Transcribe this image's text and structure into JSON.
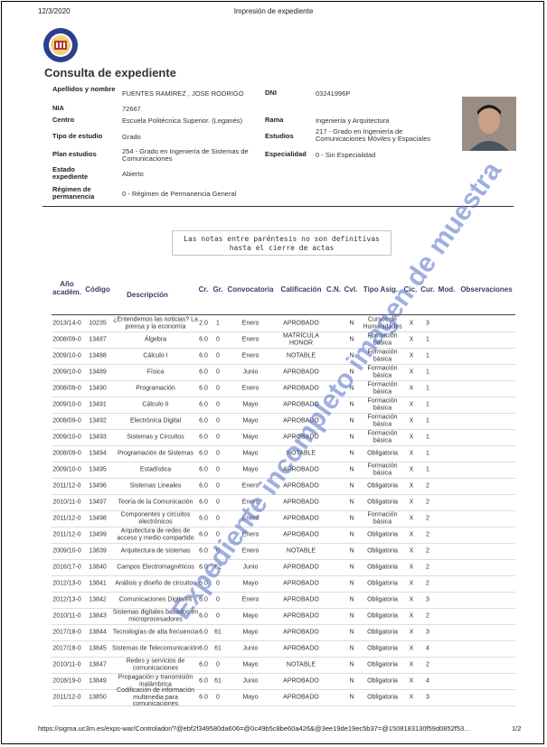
{
  "header": {
    "date": "12/3/2020",
    "title": "Impresión de expediente"
  },
  "page_title": "Consulta de expediente",
  "student": {
    "name_label": "Apellidos y nombre",
    "name": "FUENTES RAMIREZ , JOSE RODRIGO",
    "dni_label": "DNI",
    "dni": "03241996P",
    "nia_label": "NIA",
    "nia": "72667",
    "centro_label": "Centro",
    "centro": "Escuela Politécnica Superior. (Leganés)",
    "rama_label": "Rama",
    "rama": "Ingeniería y Arquitectura",
    "tipo_label": "Tipo de estudio",
    "tipo": "Grado",
    "estudios_label": "Estudios",
    "estudios": "217 - Grado en Ingeniería de Comunicaciones Móviles y Espaciales",
    "plan_label": "Plan estudios",
    "plan": "254 - Grado en Ingeniería de Sistemas de Comunicaciones",
    "especialidad_label": "Especialidad",
    "especialidad": "0 - Sin Especialidad",
    "estado_label": "Estado expediente",
    "estado": "Abierto",
    "regimen_label": "Régimen de permanencia",
    "regimen": "0 - Régimen de Permanencia General"
  },
  "notice": {
    "line1": "Las notas entre paréntesis no son definitivas",
    "line2": "hasta el cierre de actas"
  },
  "columns": [
    "Año académ.",
    "Código",
    "Descripción",
    "Cr.",
    "Gr.",
    "Convocatoria",
    "Calificación",
    "C.N.",
    "Cvl.",
    "Tipo Asig.",
    "Cic.",
    "Cur.",
    "Mod.",
    "Observaciones"
  ],
  "rows": [
    {
      "year": "2013/14-0",
      "code": "10235",
      "desc": "¿Entendemos las noticias? La prensa y la economía",
      "cr": "2.0",
      "gr": "1",
      "conv": "Enero",
      "calif": "APROBADO",
      "cn": "N",
      "tipo": "Cursos de Humanidades",
      "cic": "X",
      "cur": "3"
    },
    {
      "year": "2008/09-0",
      "code": "13487",
      "desc": "Álgebra",
      "cr": "6.0",
      "gr": "0",
      "conv": "Enero",
      "calif": "MATRÍCULA HONOR",
      "cn": "N",
      "tipo": "Formación básica",
      "cic": "X",
      "cur": "1"
    },
    {
      "year": "2009/10-0",
      "code": "13488",
      "desc": "Cálculo I",
      "cr": "6.0",
      "gr": "0",
      "conv": "Enero",
      "calif": "NOTABLE",
      "cn": "N",
      "tipo": "Formación básica",
      "cic": "X",
      "cur": "1"
    },
    {
      "year": "2009/10-0",
      "code": "13489",
      "desc": "Física",
      "cr": "6.0",
      "gr": "0",
      "conv": "Junio",
      "calif": "APROBADO",
      "cn": "N",
      "tipo": "Formación básica",
      "cic": "X",
      "cur": "1"
    },
    {
      "year": "2008/09-0",
      "code": "13490",
      "desc": "Programación",
      "cr": "6.0",
      "gr": "0",
      "conv": "Enero",
      "calif": "APROBADO",
      "cn": "N",
      "tipo": "Formación básica",
      "cic": "X",
      "cur": "1"
    },
    {
      "year": "2009/10-0",
      "code": "13491",
      "desc": "Cálculo II",
      "cr": "6.0",
      "gr": "0",
      "conv": "Mayo",
      "calif": "APROBADO",
      "cn": "N",
      "tipo": "Formación básica",
      "cic": "X",
      "cur": "1"
    },
    {
      "year": "2008/09-0",
      "code": "13492",
      "desc": "Electrónica Digital",
      "cr": "6.0",
      "gr": "0",
      "conv": "Mayo",
      "calif": "APROBADO",
      "cn": "N",
      "tipo": "Formación básica",
      "cic": "X",
      "cur": "1"
    },
    {
      "year": "2009/10-0",
      "code": "13493",
      "desc": "Sistemas y Circuitos",
      "cr": "6.0",
      "gr": "0",
      "conv": "Mayo",
      "calif": "APROBADO",
      "cn": "N",
      "tipo": "Formación básica",
      "cic": "X",
      "cur": "1"
    },
    {
      "year": "2008/09-0",
      "code": "13494",
      "desc": "Programación de Sistemas",
      "cr": "6.0",
      "gr": "0",
      "conv": "Mayo",
      "calif": "NOTABLE",
      "cn": "N",
      "tipo": "Obligatoria",
      "cic": "X",
      "cur": "1"
    },
    {
      "year": "2009/10-0",
      "code": "13495",
      "desc": "Estadística",
      "cr": "6.0",
      "gr": "0",
      "conv": "Mayo",
      "calif": "APROBADO",
      "cn": "N",
      "tipo": "Formación básica",
      "cic": "X",
      "cur": "1"
    },
    {
      "year": "2011/12-0",
      "code": "13496",
      "desc": "Sistemas Lineales",
      "cr": "6.0",
      "gr": "0",
      "conv": "Enero",
      "calif": "APROBADO",
      "cn": "N",
      "tipo": "Obligatoria",
      "cic": "X",
      "cur": "2"
    },
    {
      "year": "2010/11-0",
      "code": "13497",
      "desc": "Teoría de la Comunicación",
      "cr": "6.0",
      "gr": "0",
      "conv": "Enero",
      "calif": "APROBADO",
      "cn": "N",
      "tipo": "Obligatoria",
      "cic": "X",
      "cur": "2"
    },
    {
      "year": "2011/12-0",
      "code": "13498",
      "desc": "Componentes y circuitos electrónicos",
      "cr": "6.0",
      "gr": "0",
      "conv": "Enero",
      "calif": "APROBADO",
      "cn": "N",
      "tipo": "Formación básica",
      "cic": "X",
      "cur": "2"
    },
    {
      "year": "2011/12-0",
      "code": "13499",
      "desc": "Arquitectura de redes de acceso y medio compartido",
      "cr": "6.0",
      "gr": "0",
      "conv": "Enero",
      "calif": "APROBADO",
      "cn": "N",
      "tipo": "Obligatoria",
      "cic": "X",
      "cur": "2"
    },
    {
      "year": "2009/10-0",
      "code": "13839",
      "desc": "Arquitectura de sistemas",
      "cr": "6.0",
      "gr": "0",
      "conv": "Enero",
      "calif": "NOTABLE",
      "cn": "N",
      "tipo": "Obligatoria",
      "cic": "X",
      "cur": "2"
    },
    {
      "year": "2016/17-0",
      "code": "13840",
      "desc": "Campos Electromagnéticos",
      "cr": "6.0",
      "gr": "62",
      "conv": "Junio",
      "calif": "APROBADO",
      "cn": "N",
      "tipo": "Obligatoria",
      "cic": "X",
      "cur": "2"
    },
    {
      "year": "2012/13-0",
      "code": "13841",
      "desc": "Análisis y diseño de circuitos",
      "cr": "6.0",
      "gr": "0",
      "conv": "Mayo",
      "calif": "APROBADO",
      "cn": "N",
      "tipo": "Obligatoria",
      "cic": "X",
      "cur": "2"
    },
    {
      "year": "2012/13-0",
      "code": "13842",
      "desc": "Comunicaciones Digitales",
      "cr": "6.0",
      "gr": "0",
      "conv": "Enero",
      "calif": "APROBADO",
      "cn": "N",
      "tipo": "Obligatoria",
      "cic": "X",
      "cur": "3"
    },
    {
      "year": "2010/11-0",
      "code": "13843",
      "desc": "Sistemas digitales basados en microprocesadores",
      "cr": "6.0",
      "gr": "0",
      "conv": "Mayo",
      "calif": "APROBADO",
      "cn": "N",
      "tipo": "Obligatoria",
      "cic": "X",
      "cur": "2"
    },
    {
      "year": "2017/18-0",
      "code": "13844",
      "desc": "Tecnologías de alta frecuencia",
      "cr": "6.0",
      "gr": "61",
      "conv": "Mayo",
      "calif": "APROBADO",
      "cn": "N",
      "tipo": "Obligatoria",
      "cic": "X",
      "cur": "3"
    },
    {
      "year": "2017/18-0",
      "code": "13845",
      "desc": "Sistemas de Telecomunicación",
      "cr": "6.0",
      "gr": "61",
      "conv": "Junio",
      "calif": "APROBADO",
      "cn": "N",
      "tipo": "Obligatoria",
      "cic": "X",
      "cur": "4"
    },
    {
      "year": "2010/11-0",
      "code": "13847",
      "desc": "Redes y servicios de comunicaciones",
      "cr": "6.0",
      "gr": "0",
      "conv": "Mayo",
      "calif": "NOTABLE",
      "cn": "N",
      "tipo": "Obligatoria",
      "cic": "X",
      "cur": "2"
    },
    {
      "year": "2018/19-0",
      "code": "13849",
      "desc": "Propagación y transmisión inalámbrica",
      "cr": "6.0",
      "gr": "61",
      "conv": "Junio",
      "calif": "APROBADO",
      "cn": "N",
      "tipo": "Obligatoria",
      "cic": "X",
      "cur": "4"
    },
    {
      "year": "2011/12-0",
      "code": "13850",
      "desc": "Codificación de información multimedia para comunicaciones",
      "cr": "6.0",
      "gr": "0",
      "conv": "Mayo",
      "calif": "APROBADO",
      "cn": "N",
      "tipo": "Obligatoria",
      "cic": "X",
      "cur": "3"
    }
  ],
  "watermark": "Expediente incompleto imagen de muestra",
  "footer": {
    "url": "https://sigma.uc3m.es/exps-war/Controlador/?@ebf2f349580da606=@0c49b5c8be60a426&@3ee19de19ec5b37=@1508183130f59d0852f53…",
    "page": "1/2"
  },
  "colors": {
    "header_text": "#3a3f6a",
    "watermark": "#506ec8",
    "logo_blue": "#2a3f8f"
  }
}
